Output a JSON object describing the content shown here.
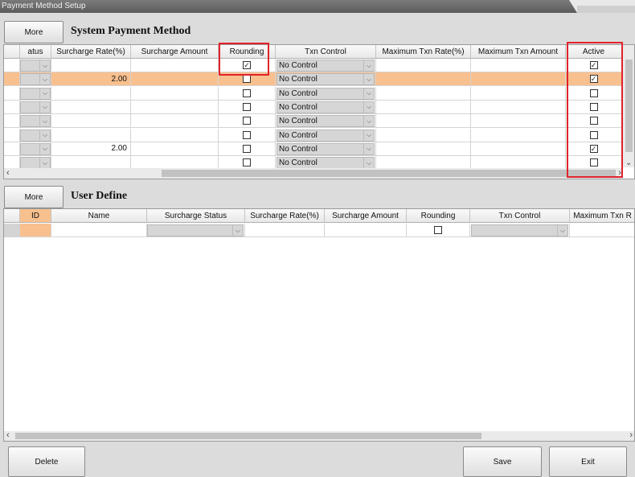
{
  "window": {
    "title": "Payment Method Setup"
  },
  "system_section": {
    "more_label": "More",
    "title": "System Payment Method",
    "headers": [
      "atus",
      "Surcharge Rate(%)",
      "Surcharge Amount",
      "Rounding",
      "Txn Control",
      "Maximum Txn Rate(%)",
      "Maximum Txn Amount",
      "Active"
    ],
    "rows": [
      {
        "rate": "",
        "rounding": true,
        "txn": "No Control",
        "active": true,
        "selected": false
      },
      {
        "rate": "2.00",
        "rounding": false,
        "txn": "No Control",
        "active": true,
        "selected": true
      },
      {
        "rate": "",
        "rounding": false,
        "txn": "No Control",
        "active": false,
        "selected": false
      },
      {
        "rate": "",
        "rounding": false,
        "txn": "No Control",
        "active": false,
        "selected": false
      },
      {
        "rate": "",
        "rounding": false,
        "txn": "No Control",
        "active": false,
        "selected": false
      },
      {
        "rate": "",
        "rounding": false,
        "txn": "No Control",
        "active": false,
        "selected": false
      },
      {
        "rate": "2.00",
        "rounding": false,
        "txn": "No Control",
        "active": true,
        "selected": false
      },
      {
        "rate": "",
        "rounding": false,
        "txn": "No Control",
        "active": false,
        "selected": false
      }
    ]
  },
  "user_section": {
    "more_label": "More",
    "title": "User Define",
    "headers": [
      "ID",
      "Name",
      "Surcharge Status",
      "Surcharge Rate(%)",
      "Surcharge Amount",
      "Rounding",
      "Txn Control",
      "Maximum Txn R"
    ],
    "rows": [
      {
        "id": "",
        "name": "",
        "status": "",
        "rate": "",
        "amount": "",
        "rounding": false,
        "txn": ""
      }
    ]
  },
  "footer": {
    "delete_label": "Delete",
    "save_label": "Save",
    "exit_label": "Exit"
  },
  "icons": {
    "check": "✓",
    "dropdown": "⌵",
    "scroll_left": "‹",
    "scroll_right": "›",
    "scroll_down": "⌄"
  },
  "colors": {
    "selected_row": "#f8c08e",
    "highlight": "#e0232c",
    "id_header": "#f8c08e"
  }
}
